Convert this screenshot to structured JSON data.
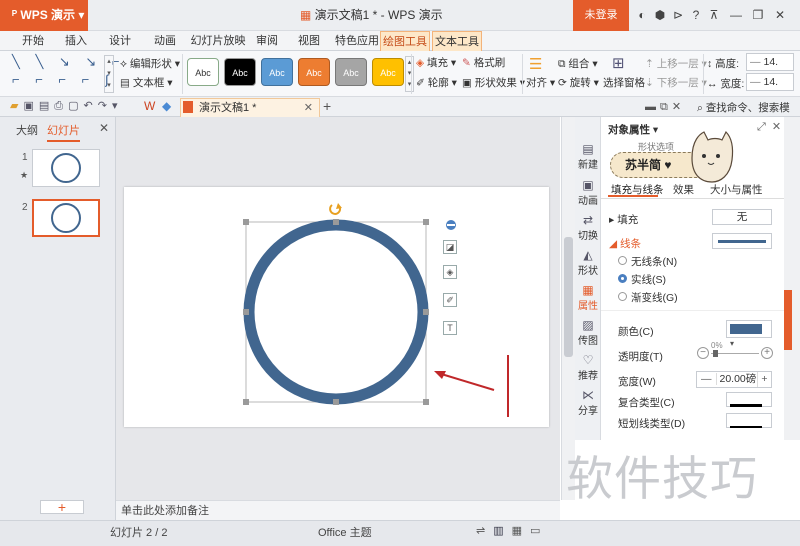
{
  "app": {
    "name": "WPS 演示",
    "title": "演示文稿1 * - WPS 演示",
    "login_label": "未登录"
  },
  "menu": {
    "items": [
      "开始",
      "插入",
      "设计",
      "动画",
      "幻灯片放映",
      "审阅",
      "视图",
      "特色应用",
      "绘图工具",
      "文本工具"
    ],
    "active": "绘图工具"
  },
  "ribbon": {
    "edit_shape": "编辑形状",
    "textbox": "文本框",
    "style_label": "Abc",
    "fill": "填充",
    "format_painter": "格式刷",
    "outline": "轮廓",
    "shape_effects": "形状效果",
    "align": "对齐",
    "group": "组合",
    "rotate": "旋转",
    "selection_pane": "选择窗格",
    "bring_forward": "上移一层",
    "send_backward": "下移一层",
    "height_label": "高度:",
    "height_value": "14.",
    "width_label": "宽度:",
    "width_value": "14."
  },
  "quick": {
    "doc_tab": "演示文稿1 *",
    "search": "查找命令、搜索模板"
  },
  "left_panel": {
    "tab_outline": "大纲",
    "tab_slides": "幻灯片",
    "slide_numbers": [
      "1",
      "2"
    ],
    "add_label": "+"
  },
  "notes": {
    "placeholder": "单击此处添加备注"
  },
  "status": {
    "slide_info": "幻灯片 2 / 2",
    "theme": "Office 主题"
  },
  "side_tabs": [
    "新建",
    "动画",
    "切换",
    "形状",
    "属性",
    "传图",
    "推荐",
    "分享"
  ],
  "properties": {
    "header": "对象属性",
    "shape_options": "形状选项",
    "tabs": [
      "填充与线条",
      "效果",
      "大小与属性"
    ],
    "fill_label": "填充",
    "fill_value": "无",
    "line_label": "线条",
    "line_options": [
      "无线条(N)",
      "实线(S)",
      "渐变线(G)"
    ],
    "line_selected": "实线(S)",
    "color_label": "颜色(C)",
    "transparency_label": "透明度(T)",
    "transparency_value": "0%",
    "width_label": "宽度(W)",
    "width_value": "20.00磅",
    "compound_label": "复合类型(C)",
    "dash_label": "短划线类型(D)"
  },
  "mascot": {
    "text": "苏半简"
  },
  "watermark": "软件技巧",
  "colors": {
    "accent": "#e45c2b",
    "circle": "#41668f",
    "arrow": "#c0282a"
  }
}
